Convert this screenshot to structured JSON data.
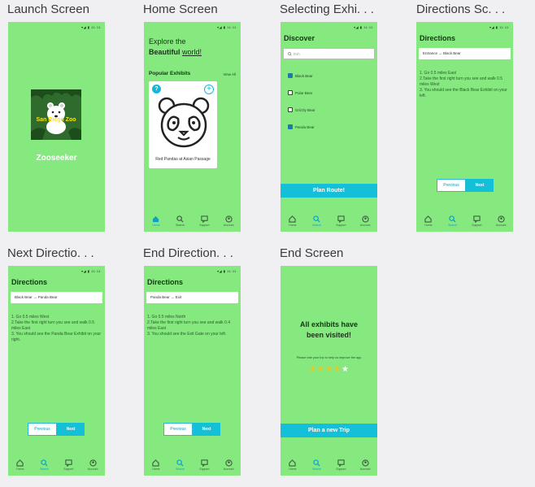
{
  "status_bar": "▾◢ ▮ 11:11",
  "nav": {
    "home": "Home",
    "search": "Search",
    "support": "Support",
    "account": "Account"
  },
  "frames": {
    "launch": {
      "label": "Launch Screen",
      "brand_text": "San Diego Zoo",
      "app_name": "Zooseeker"
    },
    "home": {
      "label": "Home Screen",
      "headline_line1": "Explore the",
      "headline_line2_bold": "Beautiful",
      "headline_line2_link": "world!",
      "popular_title": "Popular Exhibits",
      "view_all": "View All",
      "card_caption": "Red Pandas at Asian Passage",
      "plus_glyph": "+",
      "badge_glyph": "?"
    },
    "selecting": {
      "label": "Selecting Exhi. . .",
      "title": "Discover",
      "search_placeholder": "Exh",
      "items": [
        {
          "label": "Black Bear",
          "checked": true
        },
        {
          "label": "Polar Bear",
          "checked": false
        },
        {
          "label": "Grizzly Bear",
          "checked": false
        },
        {
          "label": "Panda Bear",
          "checked": true
        }
      ],
      "plan_button": "Plan Route!"
    },
    "directions": {
      "label": "Directions Sc. . .",
      "title": "Directions",
      "route": "Entrance → Black Bear",
      "steps": [
        "1. Go 0.5 miles East",
        "2.Take the first right turn you see and walk 0.5 miles West",
        "3. You should see the Black Bear Exhibit on your left."
      ]
    },
    "next": {
      "label": "Next Directio. . .",
      "title": "Directions",
      "route": "Black Bear → Panda Bear",
      "steps": [
        "1. Go 0.5 miles West",
        "2.Take the first right turn you see and walk 0.5 miles East",
        "3. You should see the Panda Bear Exhibit on your right."
      ],
      "prev_button": "Previous",
      "next_button": "Next"
    },
    "end_dir": {
      "label": "End Direction. . .",
      "title": "Directions",
      "route": "Panda Bear → Exit",
      "steps": [
        "1. Go 0.5 miles North",
        "2.Take the first right turn you see and walk 0.4 miles East",
        "3. You should see the Exit Gate on your left."
      ],
      "prev_button": "Previous",
      "next_button": "Next"
    },
    "end": {
      "label": "End Screen",
      "headline": "All exhibits have been visited!",
      "rate_prompt": "Please rate your trip to help us improve the app",
      "rating": 4,
      "rating_max": 5,
      "plan_button": "Plan a new Trip"
    }
  },
  "colors": {
    "screen_bg": "#86e980",
    "accent": "#13c0d8",
    "page_bg": "#f0f0f3"
  }
}
